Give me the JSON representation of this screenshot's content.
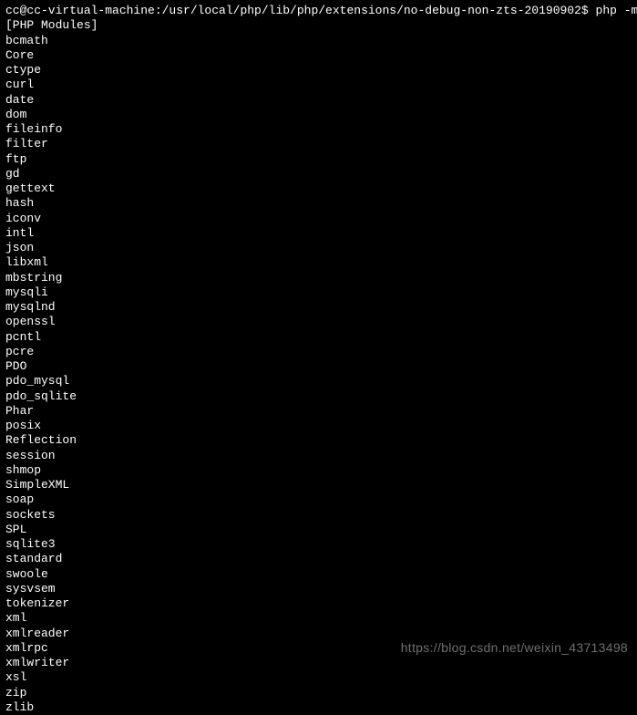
{
  "terminal": {
    "prompt": "cc@cc-virtual-machine:/usr/local/php/lib/php/extensions/no-debug-non-zts-20190902$",
    "command": "php -m",
    "header": "[PHP Modules]",
    "modules": [
      "bcmath",
      "Core",
      "ctype",
      "curl",
      "date",
      "dom",
      "fileinfo",
      "filter",
      "ftp",
      "gd",
      "gettext",
      "hash",
      "iconv",
      "intl",
      "json",
      "libxml",
      "mbstring",
      "mysqli",
      "mysqlnd",
      "openssl",
      "pcntl",
      "pcre",
      "PDO",
      "pdo_mysql",
      "pdo_sqlite",
      "Phar",
      "posix",
      "Reflection",
      "session",
      "shmop",
      "SimpleXML",
      "soap",
      "sockets",
      "SPL",
      "sqlite3",
      "standard",
      "swoole",
      "sysvsem",
      "tokenizer",
      "xml",
      "xmlreader",
      "xmlrpc",
      "xmlwriter",
      "xsl",
      "zip",
      "zlib"
    ]
  },
  "watermark": "https://blog.csdn.net/weixin_43713498"
}
